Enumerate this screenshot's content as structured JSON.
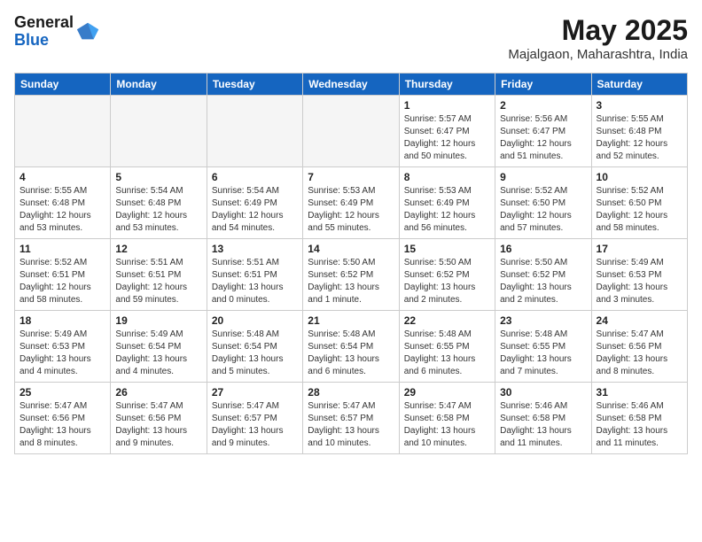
{
  "header": {
    "logo_general": "General",
    "logo_blue": "Blue",
    "month_title": "May 2025",
    "location": "Majalgaon, Maharashtra, India"
  },
  "weekdays": [
    "Sunday",
    "Monday",
    "Tuesday",
    "Wednesday",
    "Thursday",
    "Friday",
    "Saturday"
  ],
  "weeks": [
    [
      {
        "day": "",
        "info": ""
      },
      {
        "day": "",
        "info": ""
      },
      {
        "day": "",
        "info": ""
      },
      {
        "day": "",
        "info": ""
      },
      {
        "day": "1",
        "info": "Sunrise: 5:57 AM\nSunset: 6:47 PM\nDaylight: 12 hours\nand 50 minutes."
      },
      {
        "day": "2",
        "info": "Sunrise: 5:56 AM\nSunset: 6:47 PM\nDaylight: 12 hours\nand 51 minutes."
      },
      {
        "day": "3",
        "info": "Sunrise: 5:55 AM\nSunset: 6:48 PM\nDaylight: 12 hours\nand 52 minutes."
      }
    ],
    [
      {
        "day": "4",
        "info": "Sunrise: 5:55 AM\nSunset: 6:48 PM\nDaylight: 12 hours\nand 53 minutes."
      },
      {
        "day": "5",
        "info": "Sunrise: 5:54 AM\nSunset: 6:48 PM\nDaylight: 12 hours\nand 53 minutes."
      },
      {
        "day": "6",
        "info": "Sunrise: 5:54 AM\nSunset: 6:49 PM\nDaylight: 12 hours\nand 54 minutes."
      },
      {
        "day": "7",
        "info": "Sunrise: 5:53 AM\nSunset: 6:49 PM\nDaylight: 12 hours\nand 55 minutes."
      },
      {
        "day": "8",
        "info": "Sunrise: 5:53 AM\nSunset: 6:49 PM\nDaylight: 12 hours\nand 56 minutes."
      },
      {
        "day": "9",
        "info": "Sunrise: 5:52 AM\nSunset: 6:50 PM\nDaylight: 12 hours\nand 57 minutes."
      },
      {
        "day": "10",
        "info": "Sunrise: 5:52 AM\nSunset: 6:50 PM\nDaylight: 12 hours\nand 58 minutes."
      }
    ],
    [
      {
        "day": "11",
        "info": "Sunrise: 5:52 AM\nSunset: 6:51 PM\nDaylight: 12 hours\nand 58 minutes."
      },
      {
        "day": "12",
        "info": "Sunrise: 5:51 AM\nSunset: 6:51 PM\nDaylight: 12 hours\nand 59 minutes."
      },
      {
        "day": "13",
        "info": "Sunrise: 5:51 AM\nSunset: 6:51 PM\nDaylight: 13 hours\nand 0 minutes."
      },
      {
        "day": "14",
        "info": "Sunrise: 5:50 AM\nSunset: 6:52 PM\nDaylight: 13 hours\nand 1 minute."
      },
      {
        "day": "15",
        "info": "Sunrise: 5:50 AM\nSunset: 6:52 PM\nDaylight: 13 hours\nand 2 minutes."
      },
      {
        "day": "16",
        "info": "Sunrise: 5:50 AM\nSunset: 6:52 PM\nDaylight: 13 hours\nand 2 minutes."
      },
      {
        "day": "17",
        "info": "Sunrise: 5:49 AM\nSunset: 6:53 PM\nDaylight: 13 hours\nand 3 minutes."
      }
    ],
    [
      {
        "day": "18",
        "info": "Sunrise: 5:49 AM\nSunset: 6:53 PM\nDaylight: 13 hours\nand 4 minutes."
      },
      {
        "day": "19",
        "info": "Sunrise: 5:49 AM\nSunset: 6:54 PM\nDaylight: 13 hours\nand 4 minutes."
      },
      {
        "day": "20",
        "info": "Sunrise: 5:48 AM\nSunset: 6:54 PM\nDaylight: 13 hours\nand 5 minutes."
      },
      {
        "day": "21",
        "info": "Sunrise: 5:48 AM\nSunset: 6:54 PM\nDaylight: 13 hours\nand 6 minutes."
      },
      {
        "day": "22",
        "info": "Sunrise: 5:48 AM\nSunset: 6:55 PM\nDaylight: 13 hours\nand 6 minutes."
      },
      {
        "day": "23",
        "info": "Sunrise: 5:48 AM\nSunset: 6:55 PM\nDaylight: 13 hours\nand 7 minutes."
      },
      {
        "day": "24",
        "info": "Sunrise: 5:47 AM\nSunset: 6:56 PM\nDaylight: 13 hours\nand 8 minutes."
      }
    ],
    [
      {
        "day": "25",
        "info": "Sunrise: 5:47 AM\nSunset: 6:56 PM\nDaylight: 13 hours\nand 8 minutes."
      },
      {
        "day": "26",
        "info": "Sunrise: 5:47 AM\nSunset: 6:56 PM\nDaylight: 13 hours\nand 9 minutes."
      },
      {
        "day": "27",
        "info": "Sunrise: 5:47 AM\nSunset: 6:57 PM\nDaylight: 13 hours\nand 9 minutes."
      },
      {
        "day": "28",
        "info": "Sunrise: 5:47 AM\nSunset: 6:57 PM\nDaylight: 13 hours\nand 10 minutes."
      },
      {
        "day": "29",
        "info": "Sunrise: 5:47 AM\nSunset: 6:58 PM\nDaylight: 13 hours\nand 10 minutes."
      },
      {
        "day": "30",
        "info": "Sunrise: 5:46 AM\nSunset: 6:58 PM\nDaylight: 13 hours\nand 11 minutes."
      },
      {
        "day": "31",
        "info": "Sunrise: 5:46 AM\nSunset: 6:58 PM\nDaylight: 13 hours\nand 11 minutes."
      }
    ]
  ]
}
